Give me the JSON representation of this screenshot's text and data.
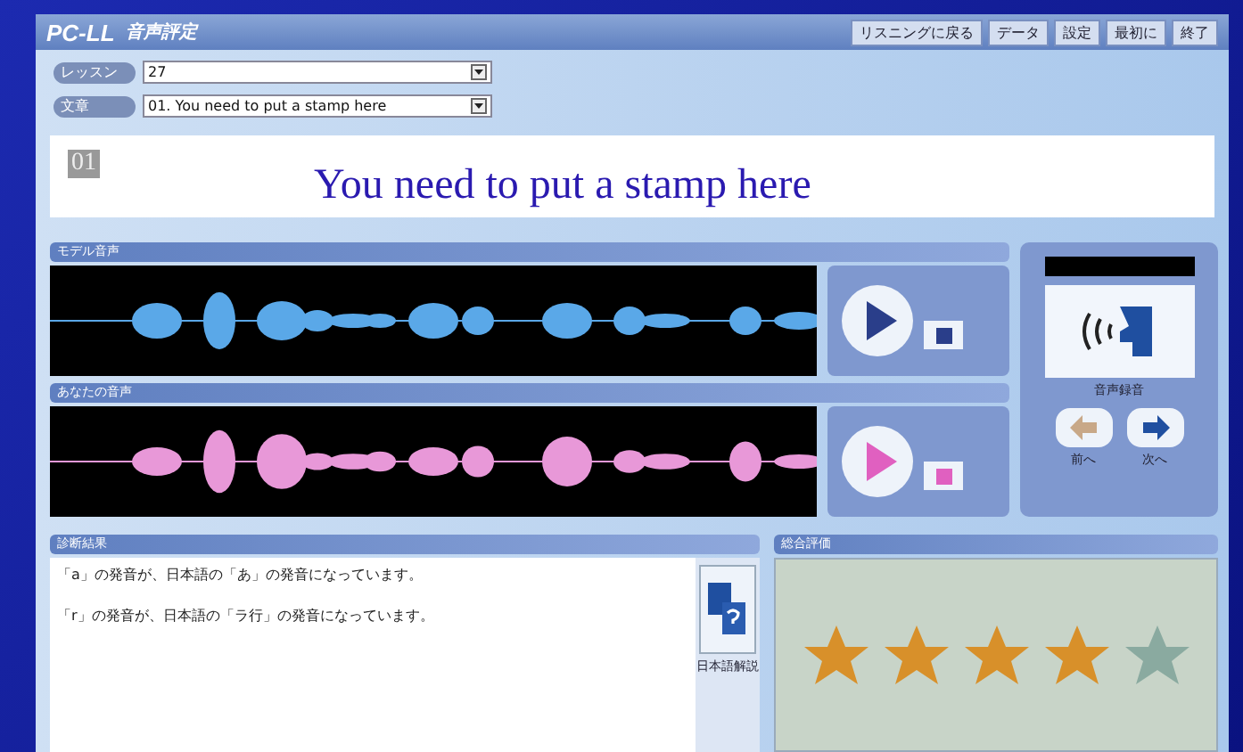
{
  "window": {
    "logo": "PC-LL",
    "title": "音声評定"
  },
  "header_buttons": [
    {
      "label": "リスニングに戻る"
    },
    {
      "label": "データ"
    },
    {
      "label": "設定"
    },
    {
      "label": "最初に"
    },
    {
      "label": "終了"
    }
  ],
  "selectors": [
    {
      "label": "レッスン",
      "value": "27"
    },
    {
      "label": "文章",
      "value": "01. You need to put a stamp here"
    }
  ],
  "sentence": {
    "number": "01",
    "text": "You need to put a stamp here"
  },
  "tracks": [
    {
      "title": "モデル音声",
      "kind": "model"
    },
    {
      "title": "あなたの音声",
      "kind": "user"
    }
  ],
  "record": {
    "label": "音声録音"
  },
  "nav": [
    {
      "label": "前へ",
      "kind": "prev"
    },
    {
      "label": "次へ",
      "kind": "next"
    }
  ],
  "advice": {
    "title": "診断結果",
    "lines": [
      "「a」の発音が、日本語の「あ」の発音になっています。",
      "「r」の発音が、日本語の「ラ行」の発音になっています。"
    ],
    "button": "日本語解説"
  },
  "rating": {
    "title": "総合評価",
    "stars": 4
  }
}
